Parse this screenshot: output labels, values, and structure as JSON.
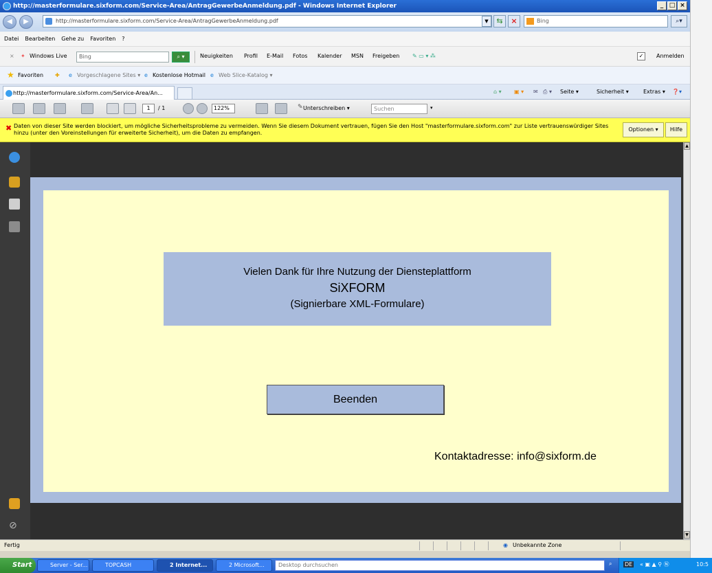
{
  "window": {
    "title": "http://masterformulare.sixform.com/Service-Area/AntragGewerbeAnmeldung.pdf - Windows Internet Explorer"
  },
  "address_bar": {
    "url": "http://masterformulare.sixform.com/Service-Area/AntragGewerbeAnmeldung.pdf",
    "search_placeholder": "Bing"
  },
  "menu": [
    "Datei",
    "Bearbeiten",
    "Gehe zu",
    "Favoriten",
    "?"
  ],
  "live_toolbar": {
    "brand": "Windows Live",
    "search_value": "Bing",
    "links": [
      "Neuigkeiten",
      "Profil",
      "E-Mail",
      "Fotos",
      "Kalender",
      "MSN",
      "Freigeben"
    ],
    "signin": "Anmelden"
  },
  "favorites_bar": {
    "favorites": "Favoriten",
    "suggested": "Vorgeschlagene Sites ▾",
    "hotmail": "Kostenlose Hotmail",
    "slice": "Web Slice-Katalog ▾"
  },
  "tab": {
    "label": "http://masterformulare.sixform.com/Service-Area/An..."
  },
  "command_bar": {
    "seite": "Seite ▾",
    "sicherheit": "Sicherheit ▾",
    "extras": "Extras ▾"
  },
  "pdf_toolbar": {
    "page_current": "1",
    "page_total": "/ 1",
    "zoom": "122%",
    "sign": "Unterschreiben ▾",
    "search_placeholder": "Suchen"
  },
  "warning": {
    "text": "Daten von dieser Site werden blockiert, um mögliche Sicherheitsprobleme zu vermeiden. Wenn Sie diesem Dokument vertrauen, fügen Sie den Host \"masterformulare.sixform.com\" zur Liste vertrauenswürdiger Sites hinzu (unter den Voreinstellungen für erweiterte Sicherheit), um die Daten zu empfangen.",
    "options": "Optionen ▾",
    "help": "Hilfe"
  },
  "document": {
    "line1": "Vielen Dank für Ihre Nutzung der Diensteplattform",
    "line2": "SiXFORM",
    "line3": "(Signierbare XML-Formulare)",
    "button": "Beenden",
    "contact": "Kontaktadresse: info@sixform.de"
  },
  "statusbar": {
    "left": "Fertig",
    "zone": "Unbekannte Zone"
  },
  "taskbar": {
    "start": "Start",
    "tasks": [
      "Server - Ser...",
      "TOPCASH",
      "2 Internet...",
      "2 Microsoft..."
    ],
    "search_placeholder": "Desktop durchsuchen",
    "lang": "DE",
    "clock": "10:5"
  },
  "colors": {
    "page_frame": "#a9bbdc",
    "page_bg": "#ffffcc",
    "warning_bg": "#ffff55",
    "viewer_bg": "#2e2e2e"
  }
}
